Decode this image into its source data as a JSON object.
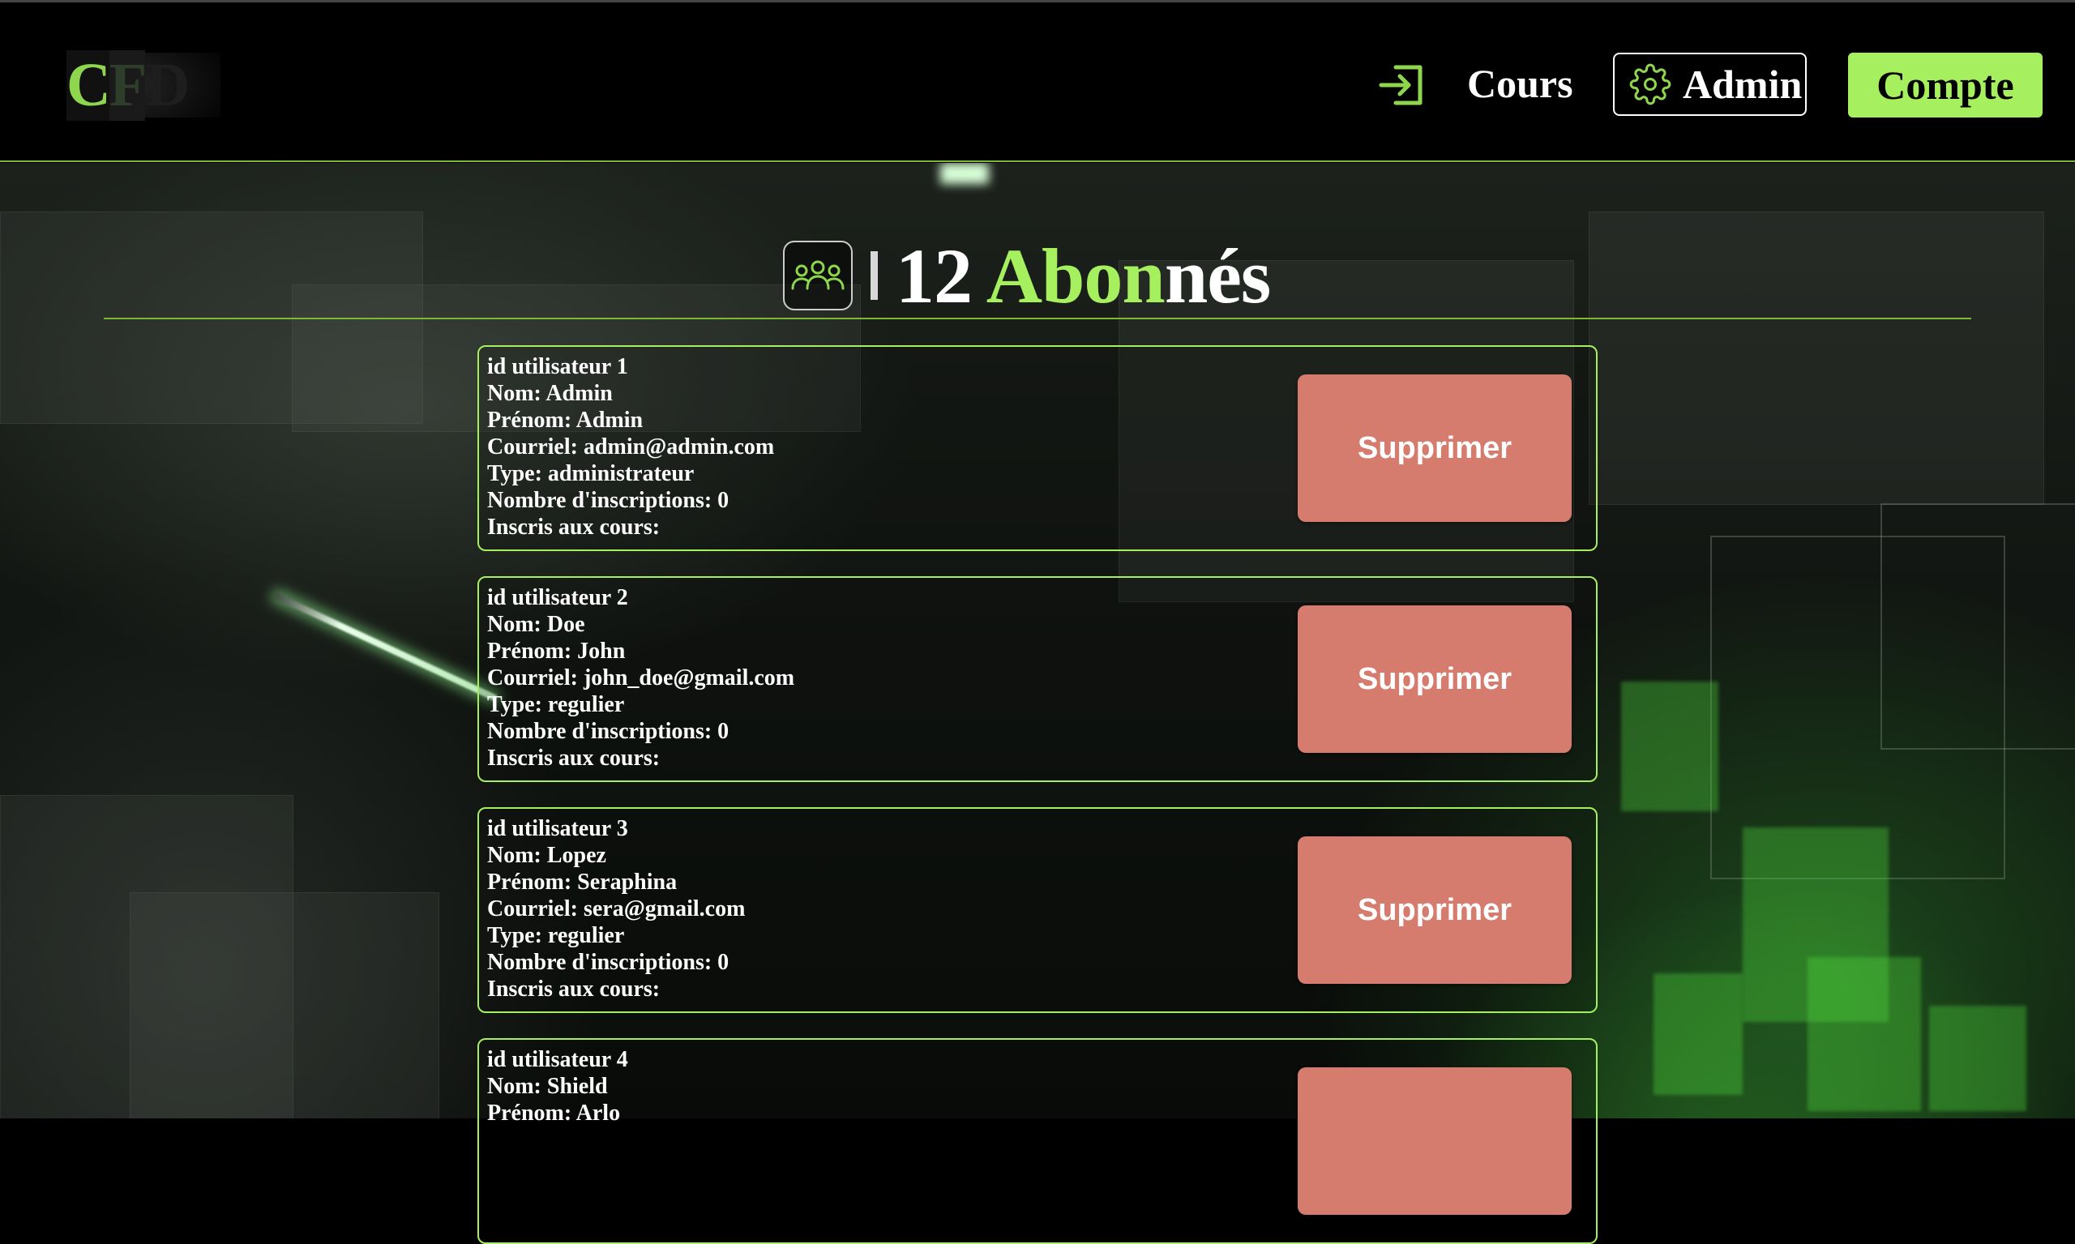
{
  "header": {
    "logo": {
      "c": "C",
      "f": "F",
      "d": "D"
    },
    "nav": {
      "cours": "Cours",
      "admin": "Admin",
      "compte": "Compte"
    }
  },
  "title": {
    "count": "12",
    "word_green": "Abon",
    "word_white": "nés"
  },
  "users": [
    {
      "id": "id utilisateur 1",
      "nom": "Nom: Admin",
      "prenom": "Prénom: Admin",
      "courriel": "Courriel: admin@admin.com",
      "type": "Type: administrateur",
      "inscriptions": "Nombre d'inscriptions: 0",
      "cours": "Inscris aux cours:",
      "delete_label": "Supprimer"
    },
    {
      "id": "id utilisateur 2",
      "nom": "Nom: Doe",
      "prenom": "Prénom: John",
      "courriel": "Courriel: john_doe@gmail.com",
      "type": "Type: regulier",
      "inscriptions": "Nombre d'inscriptions: 0",
      "cours": "Inscris aux cours:",
      "delete_label": "Supprimer"
    },
    {
      "id": "id utilisateur 3",
      "nom": "Nom: Lopez",
      "prenom": "Prénom: Seraphina",
      "courriel": "Courriel: sera@gmail.com",
      "type": "Type: regulier",
      "inscriptions": "Nombre d'inscriptions: 0",
      "cours": "Inscris aux cours:",
      "delete_label": "Supprimer"
    },
    {
      "id": "id utilisateur 4",
      "nom": "Nom: Shield",
      "prenom": "Prénom: Arlo",
      "courriel": "",
      "type": "",
      "inscriptions": "",
      "cours": "",
      "delete_label": ""
    }
  ],
  "colors": {
    "accent": "#a6ef5f",
    "rule": "#7ab836",
    "delete": "#d67c6e"
  },
  "icons": {
    "enter": "login-arrow-icon",
    "admin": "gear-icon",
    "title": "users-group-icon"
  }
}
